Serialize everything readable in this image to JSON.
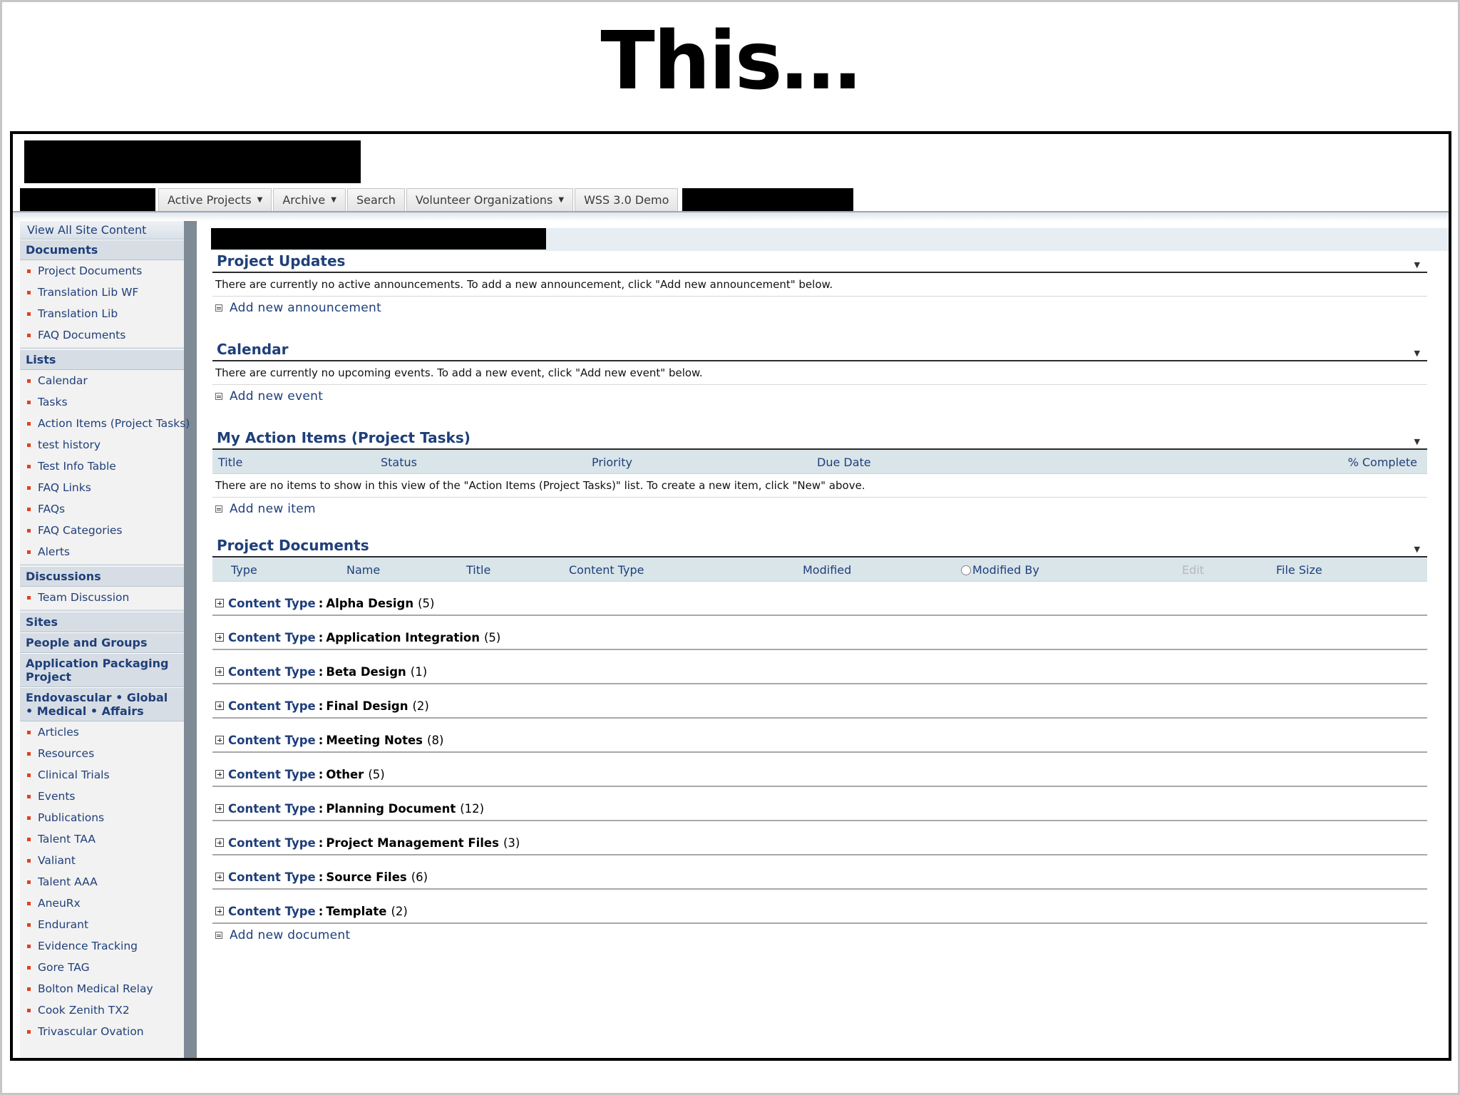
{
  "slide": {
    "title": "This…"
  },
  "topnav": {
    "tabs": [
      {
        "label": "Active Projects",
        "has_menu": true
      },
      {
        "label": "Archive",
        "has_menu": true
      },
      {
        "label": "Search",
        "has_menu": false
      },
      {
        "label": "Volunteer Organizations",
        "has_menu": true
      },
      {
        "label": "WSS 3.0 Demo",
        "has_menu": false
      }
    ]
  },
  "sidebar": {
    "view_all": "View All Site Content",
    "documents": {
      "heading": "Documents",
      "items": [
        "Project Documents",
        "Translation Lib WF",
        "Translation Lib",
        "FAQ Documents"
      ]
    },
    "lists": {
      "heading": "Lists",
      "items": [
        "Calendar",
        "Tasks",
        "Action Items (Project Tasks)",
        "test history",
        "Test Info Table",
        "FAQ Links",
        "FAQs",
        "FAQ Categories",
        "Alerts"
      ]
    },
    "discussions": {
      "heading": "Discussions",
      "items": [
        "Team Discussion"
      ]
    },
    "sites": {
      "heading": "Sites"
    },
    "people": {
      "heading": "People and Groups"
    },
    "app_packaging": {
      "heading": "Application Packaging Project"
    },
    "endo": {
      "heading": "Endovascular • Global • Medical • Affairs",
      "items": [
        "Articles",
        "Resources",
        "Clinical Trials",
        "Events",
        "Publications",
        "Talent TAA",
        "Valiant",
        "Talent AAA",
        "AneuRx",
        "Endurant",
        "Evidence Tracking",
        "Gore TAG",
        "Bolton Medical Relay",
        "Cook Zenith TX2",
        "Trivascular Ovation"
      ]
    }
  },
  "webparts": {
    "updates": {
      "title": "Project Updates",
      "text": "There are currently no active announcements. To add a new announcement, click \"Add new announcement\" below.",
      "add": "Add new announcement"
    },
    "calendar": {
      "title": "Calendar",
      "text": "There are currently no upcoming events. To add a new event, click \"Add new event\" below.",
      "add": "Add new event"
    },
    "actions": {
      "title": "My Action Items (Project Tasks)",
      "columns": [
        "Title",
        "Status",
        "Priority",
        "Due Date",
        "% Complete"
      ],
      "text": "There are no items to show in this view of the \"Action Items (Project Tasks)\" list. To create a new item, click \"New\" above.",
      "add": "Add new item"
    },
    "docs": {
      "title": "Project Documents",
      "columns": [
        "Type",
        "Name",
        "Title",
        "Content Type",
        "Modified",
        "Modified By",
        "Edit",
        "File Size"
      ],
      "group_label": "Content Type",
      "groups": [
        {
          "name": "Alpha Design",
          "count": "(5)"
        },
        {
          "name": "Application Integration",
          "count": "(5)"
        },
        {
          "name": "Beta Design",
          "count": "(1)"
        },
        {
          "name": "Final Design",
          "count": "(2)"
        },
        {
          "name": "Meeting Notes",
          "count": "(8)"
        },
        {
          "name": "Other",
          "count": "(5)"
        },
        {
          "name": "Planning Document",
          "count": "(12)"
        },
        {
          "name": "Project Management Files",
          "count": "(3)"
        },
        {
          "name": "Source Files",
          "count": "(6)"
        },
        {
          "name": "Template",
          "count": "(2)"
        }
      ],
      "add": "Add new document"
    }
  },
  "colors": {
    "link": "#1f3f7a",
    "bullet": "#e2401e",
    "header_bg": "#dae5ea"
  }
}
